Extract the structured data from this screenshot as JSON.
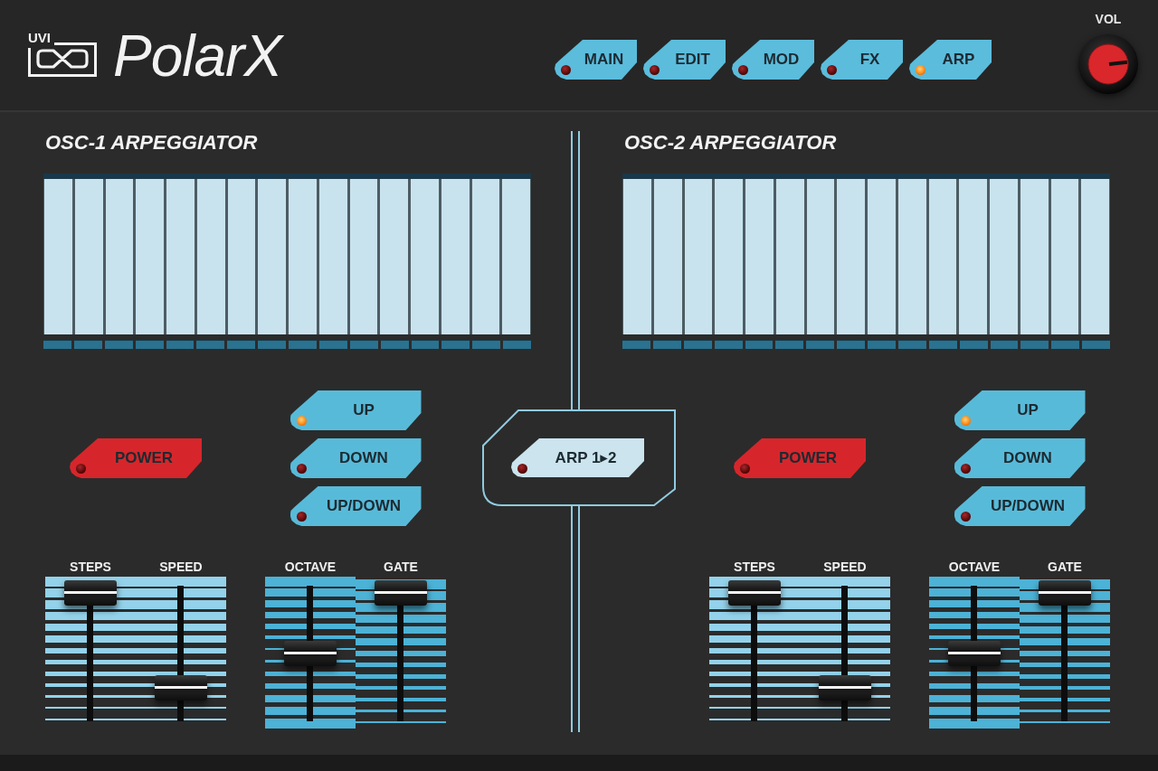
{
  "header": {
    "logo_badge": "UVI",
    "product_name": "PolarX"
  },
  "tabs": [
    {
      "label": "MAIN",
      "selected": false
    },
    {
      "label": "EDIT",
      "selected": false
    },
    {
      "label": "MOD",
      "selected": false
    },
    {
      "label": "FX",
      "selected": false
    },
    {
      "label": "ARP",
      "selected": true
    }
  ],
  "volume": {
    "label": "VOL",
    "level": 0.81
  },
  "sections": [
    {
      "title": "OSC-1 ARPEGGIATOR",
      "steps": [
        {
          "level": 1
        },
        {
          "level": 1
        },
        {
          "level": 1
        },
        {
          "level": 1
        },
        {
          "level": 1
        },
        {
          "level": 1
        },
        {
          "level": 1
        },
        {
          "level": 1
        },
        {
          "level": 1
        },
        {
          "level": 1
        },
        {
          "level": 1
        },
        {
          "level": 1
        },
        {
          "level": 1
        },
        {
          "level": 1
        },
        {
          "level": 1
        },
        {
          "level": 1
        }
      ],
      "power": {
        "label": "POWER",
        "on": false
      },
      "modes": [
        {
          "label": "UP",
          "selected": true
        },
        {
          "label": "DOWN",
          "selected": false
        },
        {
          "label": "UP/DOWN",
          "selected": false
        }
      ],
      "sliders": [
        {
          "label": "STEPS",
          "level": 0.95
        },
        {
          "label": "SPEED",
          "level": 0.25
        },
        {
          "label": "OCTAVE",
          "level": 0.5
        },
        {
          "label": "GATE",
          "level": 0.95
        }
      ]
    },
    {
      "title": "OSC-2 ARPEGGIATOR",
      "steps": [
        {
          "level": 1
        },
        {
          "level": 1
        },
        {
          "level": 1
        },
        {
          "level": 1
        },
        {
          "level": 1
        },
        {
          "level": 1
        },
        {
          "level": 1
        },
        {
          "level": 1
        },
        {
          "level": 1
        },
        {
          "level": 1
        },
        {
          "level": 1
        },
        {
          "level": 1
        },
        {
          "level": 1
        },
        {
          "level": 1
        },
        {
          "level": 1
        },
        {
          "level": 1
        }
      ],
      "power": {
        "label": "POWER",
        "on": false
      },
      "modes": [
        {
          "label": "UP",
          "selected": true
        },
        {
          "label": "DOWN",
          "selected": false
        },
        {
          "label": "UP/DOWN",
          "selected": false
        }
      ],
      "sliders": [
        {
          "label": "STEPS",
          "level": 0.95
        },
        {
          "label": "SPEED",
          "level": 0.25
        },
        {
          "label": "OCTAVE",
          "level": 0.5
        },
        {
          "label": "GATE",
          "level": 0.95
        }
      ]
    }
  ],
  "link_button": {
    "label": "ARP 1▸2",
    "on": false
  }
}
